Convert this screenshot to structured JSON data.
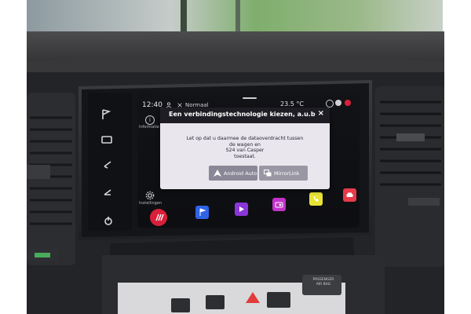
{
  "status_bar": {
    "time": "12:40",
    "mode": "Normaal",
    "temperature": "23.5 °C"
  },
  "side_menu": {
    "info_label": "Informatie",
    "settings_label": "Instellingen"
  },
  "dialog": {
    "title": "Een verbindingstechnologie kiezen, a.u.b",
    "message_lines": [
      "Let op dat u daarmee de dataoverdracht tussen",
      "de wagen en",
      "S24 van Casper",
      "toestaat."
    ],
    "options": [
      {
        "label": "Android Auto",
        "icon": "android-auto-icon"
      },
      {
        "label": "MirrorLink",
        "icon": "mirrorlink-icon"
      }
    ],
    "close_symbol": "×"
  },
  "physical_buttons": {
    "passenger_airbag_line1": "PASSENGER",
    "passenger_airbag_line2": "AIR BAG"
  },
  "colors": {
    "accent_red": "#d8203a",
    "app_blue": "#2f63e8",
    "app_purple": "#8b36d9",
    "app_magenta": "#c233c9",
    "app_yellow": "#e8e236",
    "app_red": "#e83a4a",
    "dialog_bg": "#e9e6ee",
    "dialog_header": "#1f1d24"
  }
}
